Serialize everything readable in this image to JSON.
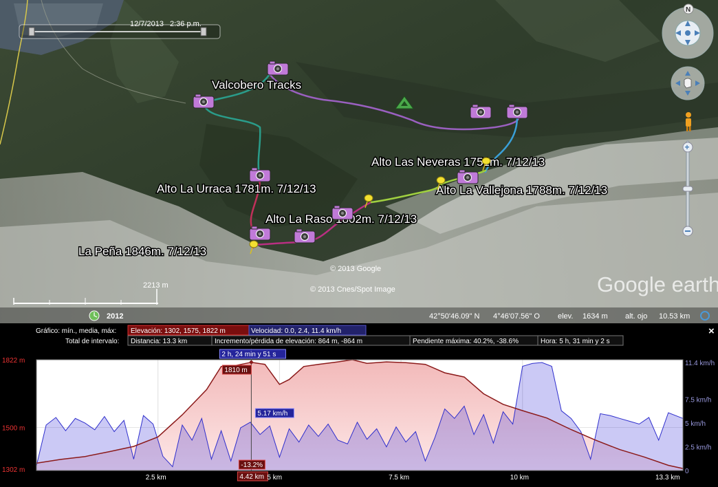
{
  "time_slider": {
    "date": "12/7/2013",
    "time": "2:36 p.m."
  },
  "map": {
    "track_title": "Valcobero Tracks",
    "placemarks": [
      {
        "label": "Alto Las Neveras 1751m. 7/12/13"
      },
      {
        "label": "Alto La Urraca 1781m. 7/12/13"
      },
      {
        "label": "Alto La Vallejona 1788m. 7/12/13"
      },
      {
        "label": "Alto La Raso 1802m. 7/12/13"
      },
      {
        "label": "La Peña 1846m. 7/12/13"
      }
    ],
    "copyright_1": "© 2013 Google",
    "copyright_2": "© 2013 Cnes/Spot Image",
    "logo": "Google earth",
    "scale": "2213 m",
    "imagery_year": "2012",
    "status": {
      "lat": "42°50'46.09\" N",
      "lon": "4°46'07.56\" O",
      "elev_label": "elev.",
      "elev": "1634 m",
      "eye_label": "alt. ojo",
      "eye": "10.53 km"
    },
    "compass_north": "N"
  },
  "profile": {
    "graph_label": "Gráfico: mín., media, máx:",
    "elevation_stat": "Elevación: 1302, 1575, 1822 m",
    "speed_stat": "Velocidad: 0.0, 2.4, 11.4 km/h",
    "interval_label": "Total de intervalo:",
    "distance": "Distancia: 13.3 km",
    "gain": "Incremento/pérdida de elevación: 864 m, -864 m",
    "slope": "Pendiente máxima: 40.2%, -38.6%",
    "duration": "Hora: 5 h, 31 min y 2 s",
    "cursor_time": "2 h, 24 min y 51 s",
    "cursor_elev": "1810 m",
    "cursor_speed": "5.17 km/h",
    "cursor_slope": "-13.2%",
    "cursor_dist": "4.42 km",
    "close": "×"
  },
  "chart_data": {
    "type": "area",
    "x_label_unit": "km",
    "x_ticks": [
      "2.5 km",
      "5 km",
      "7.5 km",
      "10 km",
      "13.3 km"
    ],
    "left_ticks": [
      "1822 m",
      "1500 m",
      "1302 m"
    ],
    "right_ticks": [
      "11.4 km/h",
      "7.5 km/h",
      "5 km/h",
      "2.5 km/h",
      "0"
    ],
    "xlim": [
      0,
      13.3
    ],
    "elevation_ylim": [
      1302,
      1822
    ],
    "speed_ylim": [
      0,
      11.4
    ],
    "series": [
      {
        "name": "Elevación",
        "color": "#8b1a1a",
        "x": [
          0,
          0.5,
          1,
          1.5,
          2,
          2.5,
          3,
          3.5,
          3.8,
          4.1,
          4.42,
          4.7,
          5,
          5.2,
          5.5,
          5.8,
          6.2,
          6.5,
          6.8,
          7.2,
          7.6,
          8,
          8.4,
          8.8,
          9.2,
          9.6,
          10,
          10.5,
          11,
          11.5,
          12,
          12.5,
          13,
          13.3
        ],
        "values": [
          1330,
          1348,
          1362,
          1385,
          1410,
          1455,
          1560,
          1680,
          1790,
          1795,
          1810,
          1800,
          1705,
          1728,
          1790,
          1800,
          1812,
          1822,
          1805,
          1812,
          1808,
          1800,
          1760,
          1740,
          1660,
          1610,
          1580,
          1545,
          1490,
          1440,
          1395,
          1360,
          1320,
          1305
        ]
      },
      {
        "name": "Velocidad",
        "color": "#2e2ecc",
        "x": [
          0,
          0.2,
          0.4,
          0.6,
          0.8,
          1,
          1.2,
          1.4,
          1.6,
          1.8,
          2,
          2.2,
          2.4,
          2.6,
          2.8,
          3,
          3.2,
          3.4,
          3.6,
          3.8,
          4,
          4.2,
          4.4,
          4.6,
          4.8,
          5,
          5.2,
          5.4,
          5.6,
          5.8,
          6,
          6.2,
          6.4,
          6.6,
          6.8,
          7,
          7.2,
          7.4,
          7.6,
          7.8,
          8,
          8.2,
          8.4,
          8.6,
          8.8,
          9,
          9.2,
          9.4,
          9.6,
          9.8,
          10,
          10.2,
          10.4,
          10.6,
          10.8,
          11,
          11.2,
          11.4,
          11.6,
          11.8,
          12,
          12.2,
          12.4,
          12.6,
          12.8,
          13,
          13.3
        ],
        "values": [
          0.5,
          4.8,
          5.6,
          4.2,
          5.5,
          5.0,
          4.3,
          5.7,
          4.1,
          5.3,
          1.2,
          5.8,
          4.9,
          1.5,
          0.4,
          4.8,
          3.2,
          5.5,
          1.2,
          4.2,
          1.0,
          4.5,
          5.1,
          3.8,
          4.7,
          1.4,
          4.4,
          3.0,
          4.8,
          3.6,
          4.9,
          3.2,
          2.8,
          5.1,
          3.3,
          4.4,
          2.5,
          4.6,
          3.0,
          4.1,
          1.0,
          3.5,
          6.5,
          5.5,
          6.8,
          3.8,
          5.9,
          2.9,
          6.2,
          4.9,
          11.0,
          11.3,
          11.4,
          11.0,
          6.3,
          5.5,
          4.1,
          1.2,
          6.0,
          5.8,
          5.5,
          5.2,
          4.9,
          5.6,
          3.2,
          6.1,
          5.5
        ]
      }
    ]
  }
}
